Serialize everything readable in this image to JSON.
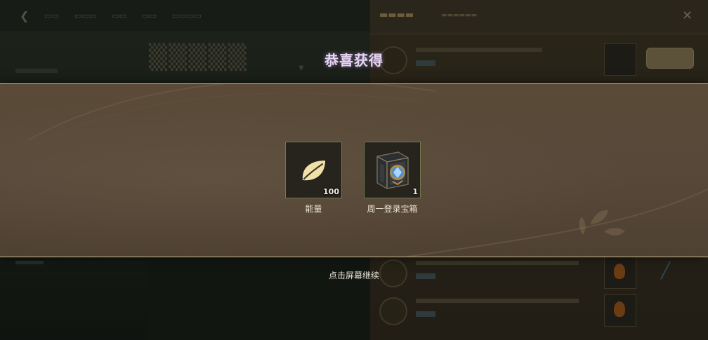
{
  "modal": {
    "title": "恭喜获得",
    "rewards": [
      {
        "name": "能量",
        "quantity": "100",
        "icon": "leaf-icon"
      },
      {
        "name": "周一登录宝箱",
        "quantity": "1",
        "icon": "treasure-chest-icon"
      }
    ],
    "continue_hint": "点击屏幕继续"
  },
  "colors": {
    "band": "#57483a",
    "band_border": "#cdbf91",
    "title_glow": "#e6d6f3",
    "leaf": "#efe1a8",
    "chest_gem": "#4a8fd6"
  }
}
